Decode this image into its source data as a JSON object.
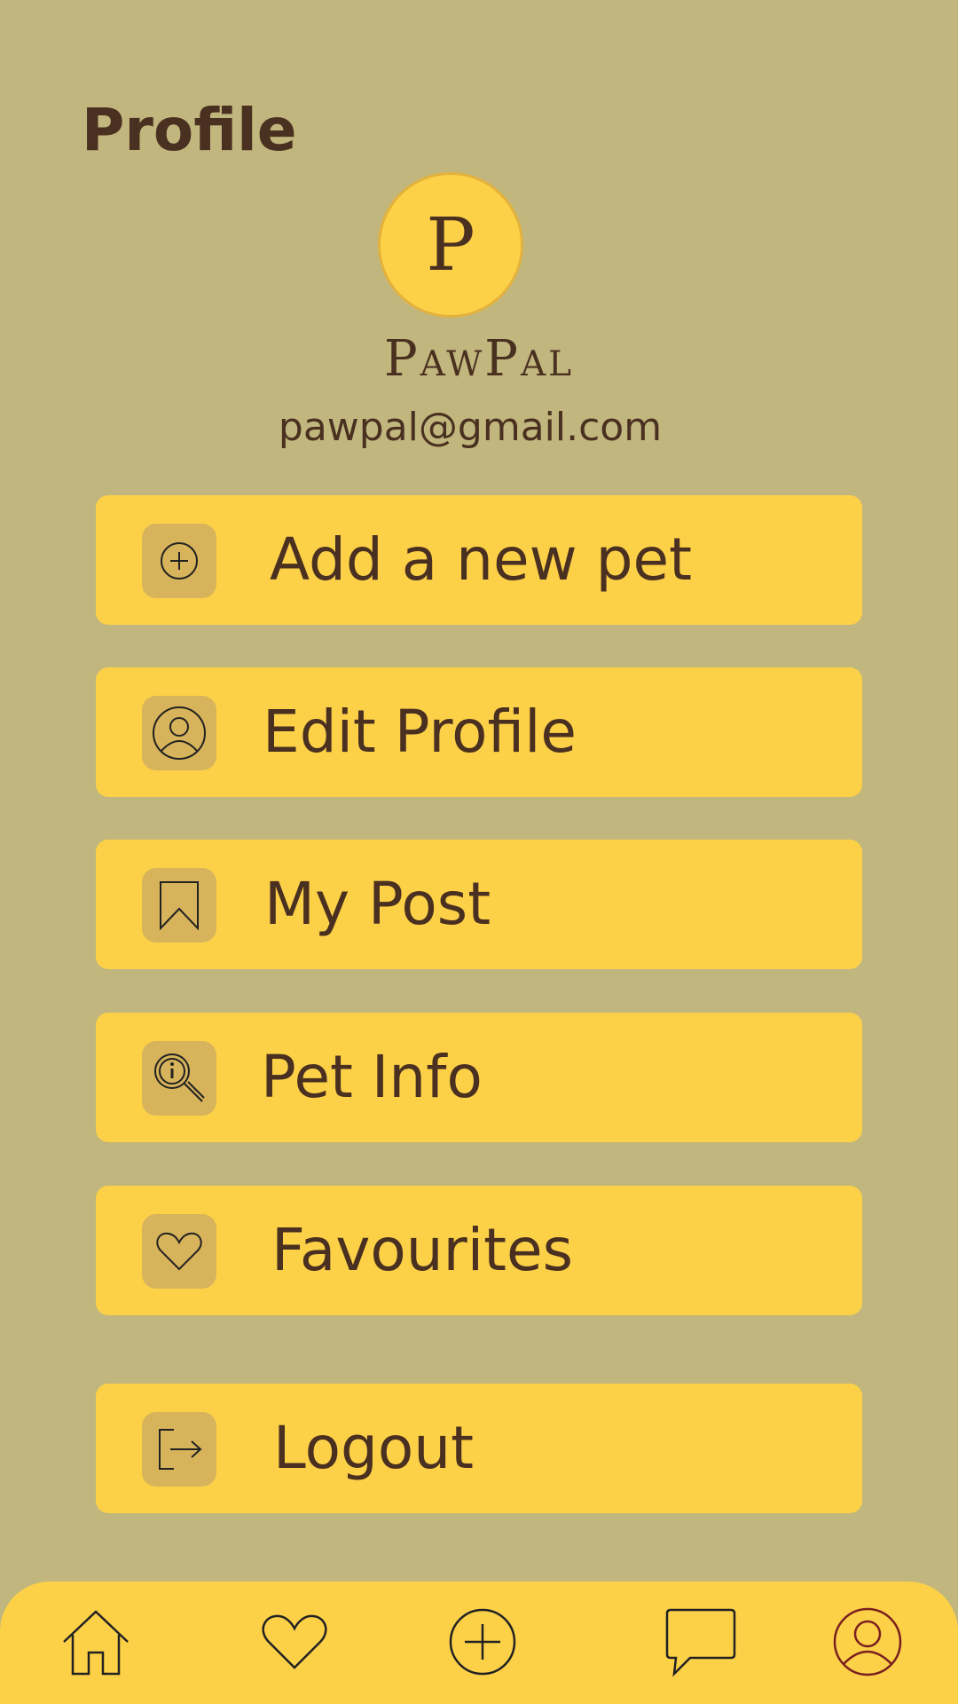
{
  "header": {
    "title": "Profile"
  },
  "profile": {
    "avatar_letter": "P",
    "name": "PawPal",
    "email": "pawpal@gmail.com"
  },
  "menu": {
    "items": [
      {
        "label": "Add a new pet",
        "icon": "plus-circle-icon"
      },
      {
        "label": "Edit Profile",
        "icon": "user-circle-icon"
      },
      {
        "label": "My Post",
        "icon": "bookmark-icon"
      },
      {
        "label": "Pet Info",
        "icon": "info-search-icon"
      },
      {
        "label": "Favourites",
        "icon": "heart-icon"
      },
      {
        "label": "Logout",
        "icon": "logout-icon"
      }
    ]
  },
  "bottom_nav": {
    "items": [
      {
        "icon": "home-icon"
      },
      {
        "icon": "heart-icon"
      },
      {
        "icon": "plus-circle-icon"
      },
      {
        "icon": "chat-bubble-icon"
      },
      {
        "icon": "user-circle-icon",
        "active": true
      }
    ]
  },
  "colors": {
    "background": "#c1b67d",
    "card": "#fcd148",
    "icon_tile": "#d7b45b",
    "text": "#4a3020",
    "active_nav": "#7a1f1f"
  }
}
